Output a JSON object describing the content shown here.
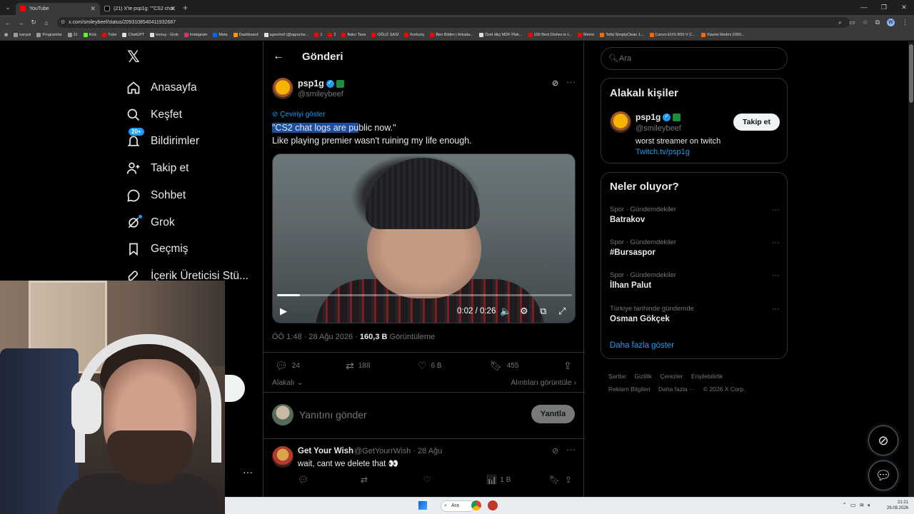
{
  "browser": {
    "tabs": [
      {
        "title": "YouTube",
        "active": true
      },
      {
        "title": "(21) X'te psp1g: \"\"CS2 chat logs...",
        "active": false
      }
    ],
    "url": "x.com/smileybeef/status/2093108540411932687",
    "profile_initial": "W",
    "bookmarks": [
      "karışık",
      "Programlar",
      "31",
      "Kick",
      "Tube",
      "ChatGPT",
      "konuş - Grok",
      "Instagram",
      "Meta",
      "Dashboard",
      "agrechef (@agreche...",
      "1",
      "2",
      "Bakır Tava",
      "OĞUZ SASİ",
      "Korkunç",
      "Ben Bildim | Arkada...",
      "Özel dilçi MDF Plak...",
      "100 Best Dishes in t...",
      "Meme",
      "Tefal SimplyClean 1...",
      "Canon EOS R50 V C...",
      "Xiaomi Redmi 2000..."
    ]
  },
  "nav": {
    "items": [
      {
        "label": "Anasayfa",
        "icon": "home-icon"
      },
      {
        "label": "Keşfet",
        "icon": "search-icon"
      },
      {
        "label": "Bildirimler",
        "icon": "bell-icon",
        "badge": "20+"
      },
      {
        "label": "Takip et",
        "icon": "add-person-icon"
      },
      {
        "label": "Sohbet",
        "icon": "chat-icon"
      },
      {
        "label": "Grok",
        "icon": "grok-icon"
      },
      {
        "label": "Geçmiş",
        "icon": "bookmark-icon"
      },
      {
        "label": "İçerik Üreticisi Stü...",
        "icon": "rocket-icon"
      }
    ]
  },
  "header": {
    "title": "Gönderi"
  },
  "post": {
    "author_name": "psp1g",
    "author_handle": "@smileybeef",
    "translate": "Çeviriyi göster",
    "text_line1_selected": "\"CS2 chat logs are pu",
    "text_line1_rest": "blic now.\"",
    "text_line2": "Like playing premier wasn't ruining my life enough.",
    "video": {
      "time": "0:02 / 0:26",
      "progress_fraction": 0.077
    },
    "meta_time": "ÖÖ 1:48 · 28 Ağu 2026 · ",
    "views_count": "160,3 B",
    "views_label": "Görüntüleme",
    "replies": "24",
    "reposts": "188",
    "likes": "6 B",
    "bookmarks": "455",
    "related": "Alakalı",
    "quotes": "Alıntıları görüntüle"
  },
  "reply_box": {
    "placeholder": "Yanıtını gönder",
    "button": "Yanıtla"
  },
  "reply": {
    "name": "Get Your Wish",
    "handle": "@GetYourrWish · 28 Ağu",
    "text": "wait, cant we delete that 👀",
    "views": "1 B"
  },
  "search": {
    "placeholder": "Ara"
  },
  "related_people": {
    "title": "Alakalı kişiler",
    "name": "psp1g",
    "handle": "@smileybeef",
    "bio": "worst streamer on twitch",
    "link": "Twitch.tv/psp1g",
    "follow": "Takip et"
  },
  "trends": {
    "title": "Neler oluyor?",
    "items": [
      {
        "category": "Spor · Gündemdekiler",
        "name": "Batrakov"
      },
      {
        "category": "Spor · Gündemdekiler",
        "name": "#Bursaspor"
      },
      {
        "category": "Spor · Gündemdekiler",
        "name": "İlhan Palut"
      },
      {
        "category": "Türkiye tarihinde gündemde",
        "name": "Osman Gökçek"
      }
    ],
    "show_more": "Daha fazla göster"
  },
  "footer": [
    "Şartlar",
    "Gizlilik",
    "Çerezler",
    "Erişilebilirlik",
    "Reklam Bilgileri",
    "Daha fazla ···",
    "© 2026 X Corp."
  ],
  "taskbar": {
    "search": "Ara",
    "time": "21:21",
    "date": "29.08.2026"
  }
}
